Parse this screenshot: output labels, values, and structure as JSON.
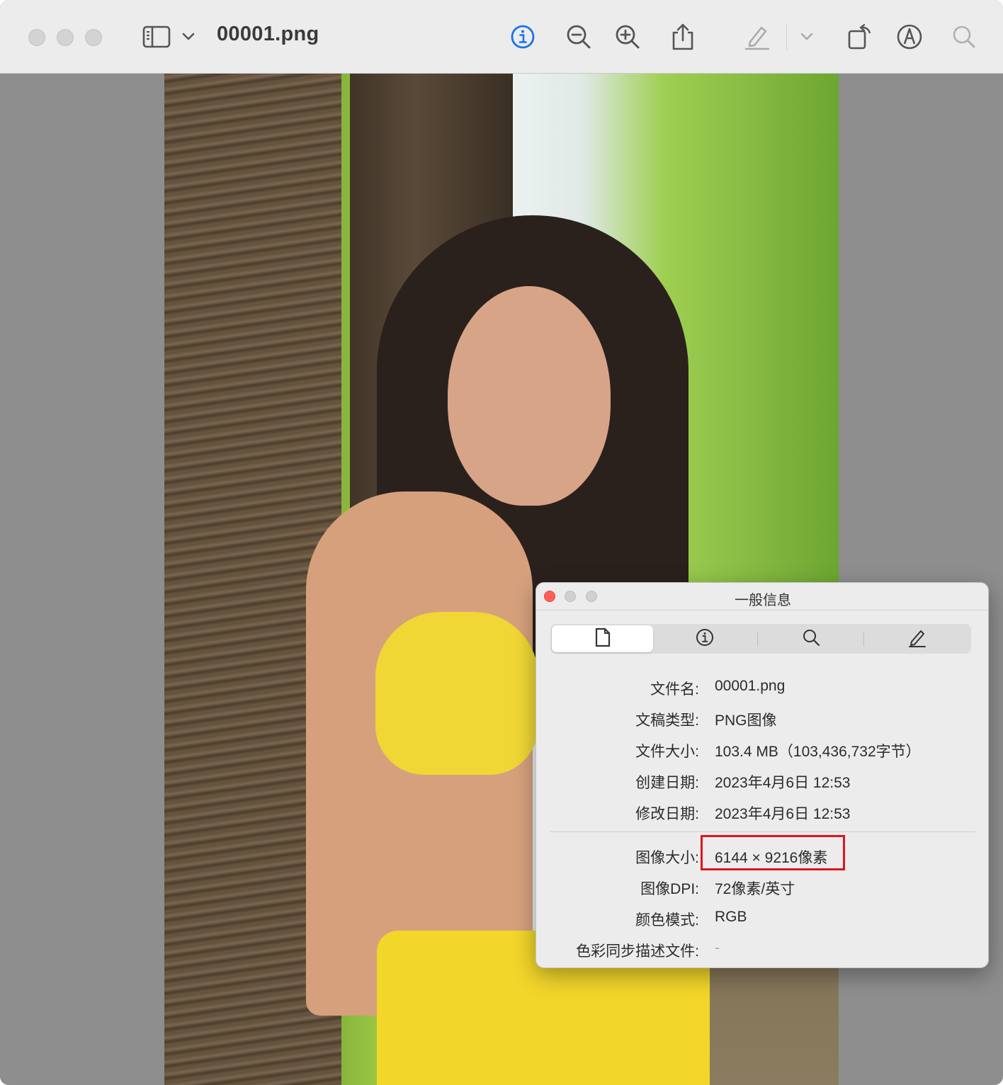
{
  "window": {
    "title": "00001.png",
    "traffic_lights": [
      "close",
      "minimize",
      "zoom"
    ],
    "toolbar": {
      "sidebar_icon": "sidebar-icon",
      "sidebar_menu_icon": "chevron-down-icon",
      "info_icon": "info-icon",
      "zoom_out_icon": "zoom-out-icon",
      "zoom_in_icon": "zoom-in-icon",
      "share_icon": "share-icon",
      "highlight_icon": "highlighter-icon",
      "highlight_menu_icon": "chevron-down-icon",
      "rotate_icon": "rotate-icon",
      "markup_icon": "markup-icon",
      "search_icon": "search-icon",
      "accent_color": "#1a73e8"
    }
  },
  "info_panel": {
    "title": "一般信息",
    "tabs": [
      {
        "name": "general",
        "icon": "document-icon",
        "active": true
      },
      {
        "name": "more-info",
        "icon": "info-icon",
        "active": false
      },
      {
        "name": "keywords",
        "icon": "search-icon",
        "active": false
      },
      {
        "name": "annotations",
        "icon": "pencil-icon",
        "active": false
      }
    ],
    "fields": [
      {
        "label": "文件名:",
        "value": "00001.png"
      },
      {
        "label": "文稿类型:",
        "value": "PNG图像"
      },
      {
        "label": "文件大小:",
        "value": "103.4 MB（103,436,732字节）"
      },
      {
        "label": "创建日期:",
        "value": "2023年4月6日 12:53"
      },
      {
        "label": "修改日期:",
        "value": "2023年4月6日 12:53"
      }
    ],
    "image_fields": [
      {
        "label": "图像大小:",
        "value": "6144 × 9216像素"
      },
      {
        "label": "图像DPI:",
        "value": "72像素/英寸"
      },
      {
        "label": "颜色模式:",
        "value": "RGB"
      },
      {
        "label": "色彩同步描述文件:",
        "value": "-"
      }
    ],
    "highlight_color": "#e0141c"
  }
}
